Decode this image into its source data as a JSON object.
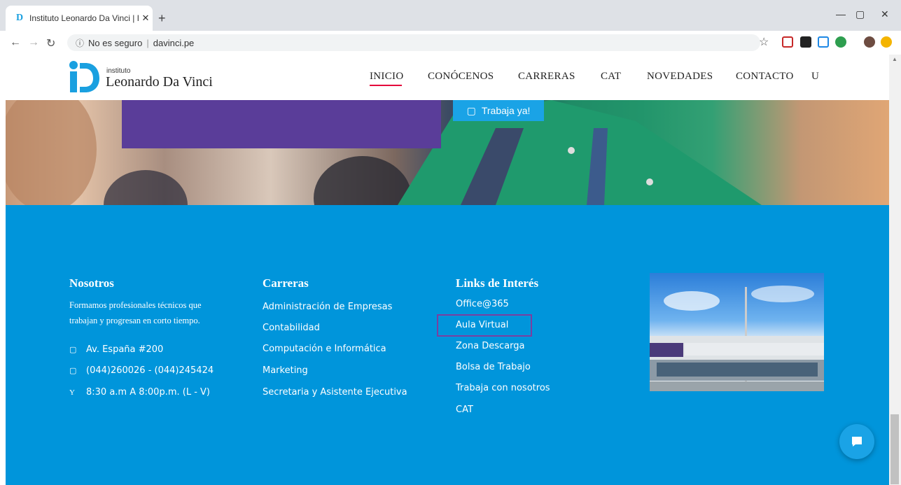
{
  "browser": {
    "tab_title": "Instituto Leonardo Da Vinci | Insti",
    "tab_favicon": "D",
    "url_security": "No es seguro",
    "url": "davinci.pe"
  },
  "site": {
    "logo_small": "instituto",
    "logo_big": "Leonardo Da Vinci",
    "menu": [
      "INICIO",
      "CONÓCENOS",
      "CARRERAS",
      "CAT",
      "NOVEDADES",
      "CONTACTO",
      "U"
    ],
    "hero_button": "Trabaja ya!"
  },
  "footer": {
    "nosotros": {
      "title": "Nosotros",
      "text1": "Formamos profesionales técnicos que",
      "text2": "trabajan y progresan en corto tiempo.",
      "address": "Av. España #200",
      "phone": "(044)260026 - (044)245424",
      "hours_icon": "Y",
      "hours": "8:30 a.m A 8:00p.m. (L - V)"
    },
    "carreras": {
      "title": "Carreras",
      "items": [
        "Administración de Empresas",
        "Contabilidad",
        "Computación e Informática",
        "Marketing",
        "Secretaria y Asistente Ejecutiva"
      ]
    },
    "links": {
      "title": "Links de Interés",
      "items": [
        "Office@365",
        "Aula Virtual",
        "Zona Descarga",
        "Bolsa de Trabajo",
        "Trabaja con nosotros",
        "CAT"
      ]
    }
  },
  "colors": {
    "footer_bg": "#0095db",
    "accent_red": "#e4003b",
    "purple": "#5a3d99",
    "highlight_border": "#7a3fa0"
  }
}
